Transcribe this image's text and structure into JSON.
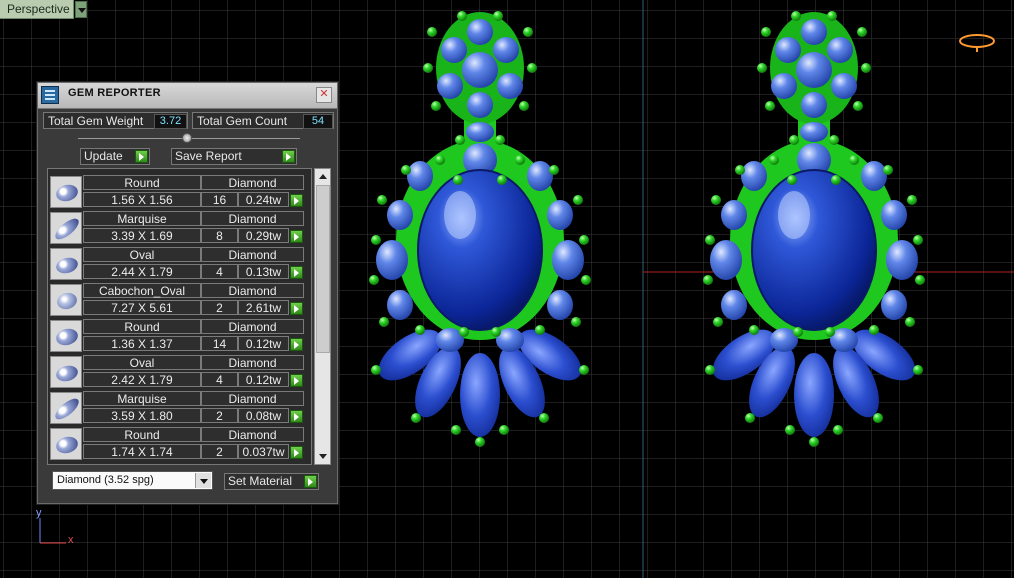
{
  "viewport": {
    "view_label": "Perspective",
    "axis_y": "y",
    "axis_x": "x"
  },
  "panel": {
    "title": "GEM REPORTER",
    "close_glyph": "✕",
    "total_weight_label": "Total Gem Weight",
    "total_weight_value": "3.72",
    "total_count_label": "Total Gem Count",
    "total_count_value": "54",
    "update_label": "Update",
    "save_report_label": "Save Report",
    "gems": [
      {
        "shape": "Round",
        "dims": "1.56 X 1.56",
        "material": "Diamond",
        "count": "16",
        "weight": "0.24tw",
        "icon": "round-gem-icon"
      },
      {
        "shape": "Marquise",
        "dims": "3.39 X 1.69",
        "material": "Diamond",
        "count": "8",
        "weight": "0.29tw",
        "icon": "marquise-gem-icon"
      },
      {
        "shape": "Oval",
        "dims": "2.44 X 1.79",
        "material": "Diamond",
        "count": "4",
        "weight": "0.13tw",
        "icon": "oval-gem-icon"
      },
      {
        "shape": "Cabochon_Oval",
        "dims": "7.27 X 5.61",
        "material": "Diamond",
        "count": "2",
        "weight": "2.61tw",
        "icon": "cabochon-gem-icon"
      },
      {
        "shape": "Round",
        "dims": "1.36 X 1.37",
        "material": "Diamond",
        "count": "14",
        "weight": "0.12tw",
        "icon": "round-gem-icon"
      },
      {
        "shape": "Oval",
        "dims": "2.42 X 1.79",
        "material": "Diamond",
        "count": "4",
        "weight": "0.12tw",
        "icon": "oval-gem-icon"
      },
      {
        "shape": "Marquise",
        "dims": "3.59 X 1.80",
        "material": "Diamond",
        "count": "2",
        "weight": "0.08tw",
        "icon": "marquise-gem-icon"
      },
      {
        "shape": "Round",
        "dims": "1.74 X 1.74",
        "material": "Diamond",
        "count": "2",
        "weight": "0.037tw",
        "icon": "round-gem-icon"
      }
    ],
    "material_select": "Diamond    (3.52 spg)",
    "set_material_label": "Set Material"
  },
  "colors": {
    "gem_blue": "#1d3aa8",
    "prong_green": "#22d822",
    "grid": "#3a3a3a",
    "axis_red": "#b02020"
  }
}
